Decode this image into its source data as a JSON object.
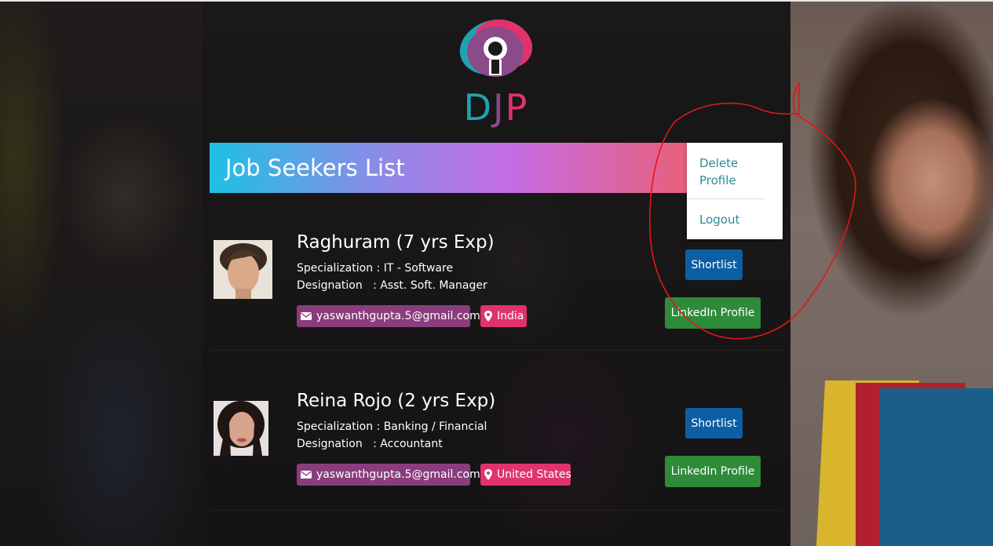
{
  "logo": {
    "letters": [
      "D",
      "J",
      "P"
    ],
    "colors": {
      "teal": "#1fa3b3",
      "purple": "#8b4a8a",
      "pink": "#e0336c"
    }
  },
  "banner": {
    "title": "Job Seekers List"
  },
  "menu": {
    "items": [
      {
        "label": "Delete Profile"
      },
      {
        "label": "Logout"
      }
    ]
  },
  "seekers": [
    {
      "name": "Raghuram (7 yrs Exp)",
      "specialization_label": "Specialization :",
      "specialization": "IT - Software",
      "designation_label": "Designation   :",
      "designation": "Asst. Soft. Manager",
      "email": "yaswanthgupta.5@gmail.com",
      "location": "India",
      "shortlist_label": "Shortlist",
      "linkedin_label": "LinkedIn Profile"
    },
    {
      "name": "Reina Rojo (2 yrs Exp)",
      "specialization_label": "Specialization :",
      "specialization": "Banking / Financial",
      "designation_label": "Designation   :",
      "designation": "Accountant",
      "email": "yaswanthgupta.5@gmail.com",
      "location": "United States",
      "shortlist_label": "Shortlist",
      "linkedin_label": "LinkedIn Profile"
    }
  ],
  "icons": {
    "email": "mail-icon",
    "location": "map-pin-icon"
  },
  "colors": {
    "shortlist": "#0c5ea5",
    "linkedin": "#2e8b3a",
    "email_chip": "#8a3d7c",
    "location_chip": "#e0336c",
    "annotation": "#e01818"
  }
}
